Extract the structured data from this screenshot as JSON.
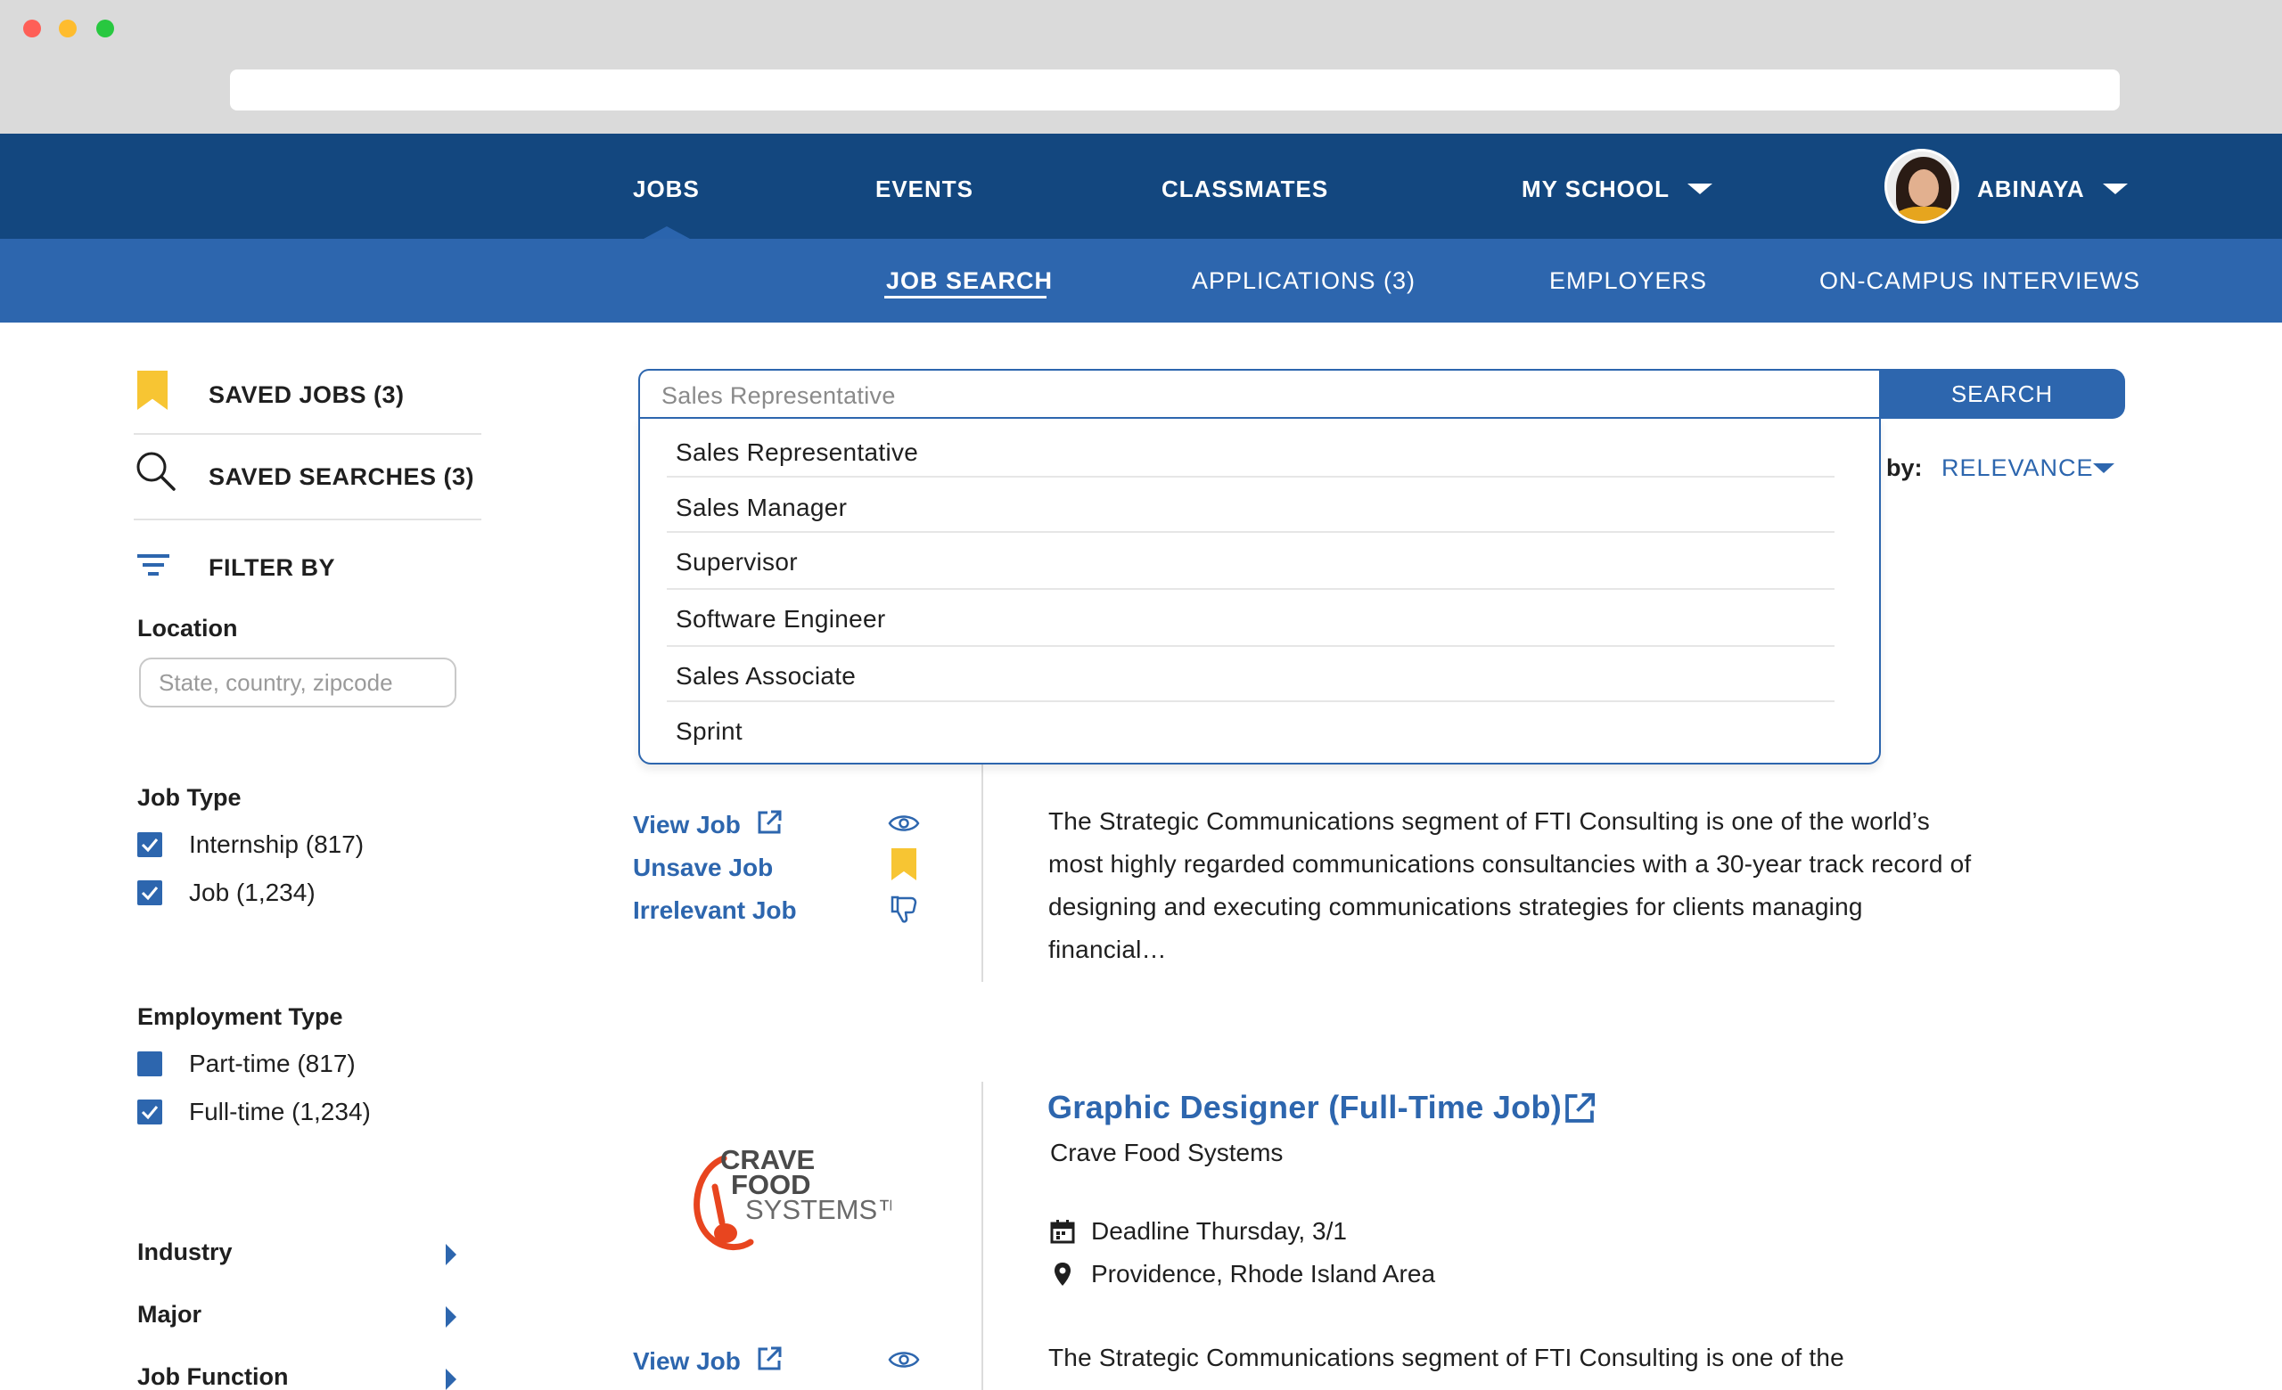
{
  "nav": {
    "items": [
      "JOBS",
      "EVENTS",
      "CLASSMATES",
      "MY SCHOOL"
    ],
    "user_name": "ABINAYA"
  },
  "subnav": {
    "items": [
      "JOB SEARCH",
      "APPLICATIONS (3)",
      "EMPLOYERS",
      "ON-CAMPUS INTERVIEWS"
    ]
  },
  "sidebar": {
    "saved_jobs": "SAVED JOBS (3)",
    "saved_searches": "SAVED SEARCHES (3)",
    "filter_by": "FILTER BY",
    "location_title": "Location",
    "location_placeholder": "State, country, zipcode",
    "job_type_title": "Job Type",
    "job_types": [
      "Internship (817)",
      "Job (1,234)"
    ],
    "employment_type_title": "Employment Type",
    "employment_types": [
      "Part-time (817)",
      "Full-time (1,234)"
    ],
    "expanders": [
      "Industry",
      "Major",
      "Job Function"
    ]
  },
  "search": {
    "value": "Sales Representative",
    "button": "SEARCH",
    "suggestions": [
      "Sales Representative",
      "Sales Manager",
      "Supervisor",
      "Software Engineer",
      "Sales Associate",
      "Sprint"
    ]
  },
  "sort": {
    "label": "by:",
    "value": "RELEVANCE"
  },
  "job1": {
    "actions": [
      "View Job",
      "Unsave Job",
      "Irrelevant Job"
    ],
    "description": "The Strategic Communications segment of FTI Consulting is one of the world’s most highly regarded communications consultancies with a 30-year track record of designing and executing communications strategies for clients managing financial…"
  },
  "job2": {
    "title": "Graphic Designer (Full-Time Job)",
    "company": "Crave Food Systems",
    "logo_text": [
      "CRAVE",
      "FOOD",
      "SYSTEMS™"
    ],
    "deadline": "Deadline Thursday, 3/1",
    "location": "Providence, Rhode Island Area",
    "view_job": "View Job",
    "description": "The Strategic Communications segment of FTI Consulting is one of the"
  },
  "colors": {
    "nav": "#13477f",
    "subnav": "#2d66ae",
    "accent": "#2d66ae",
    "saved": "#f7c533",
    "logo_orange": "#e8451f"
  },
  "icons": [
    "bookmark-icon",
    "search-icon",
    "filter-icon",
    "external-link-icon",
    "eye-icon",
    "thumbs-down-icon",
    "calendar-icon",
    "map-pin-icon",
    "chevron-down-icon",
    "caret-right-icon"
  ]
}
